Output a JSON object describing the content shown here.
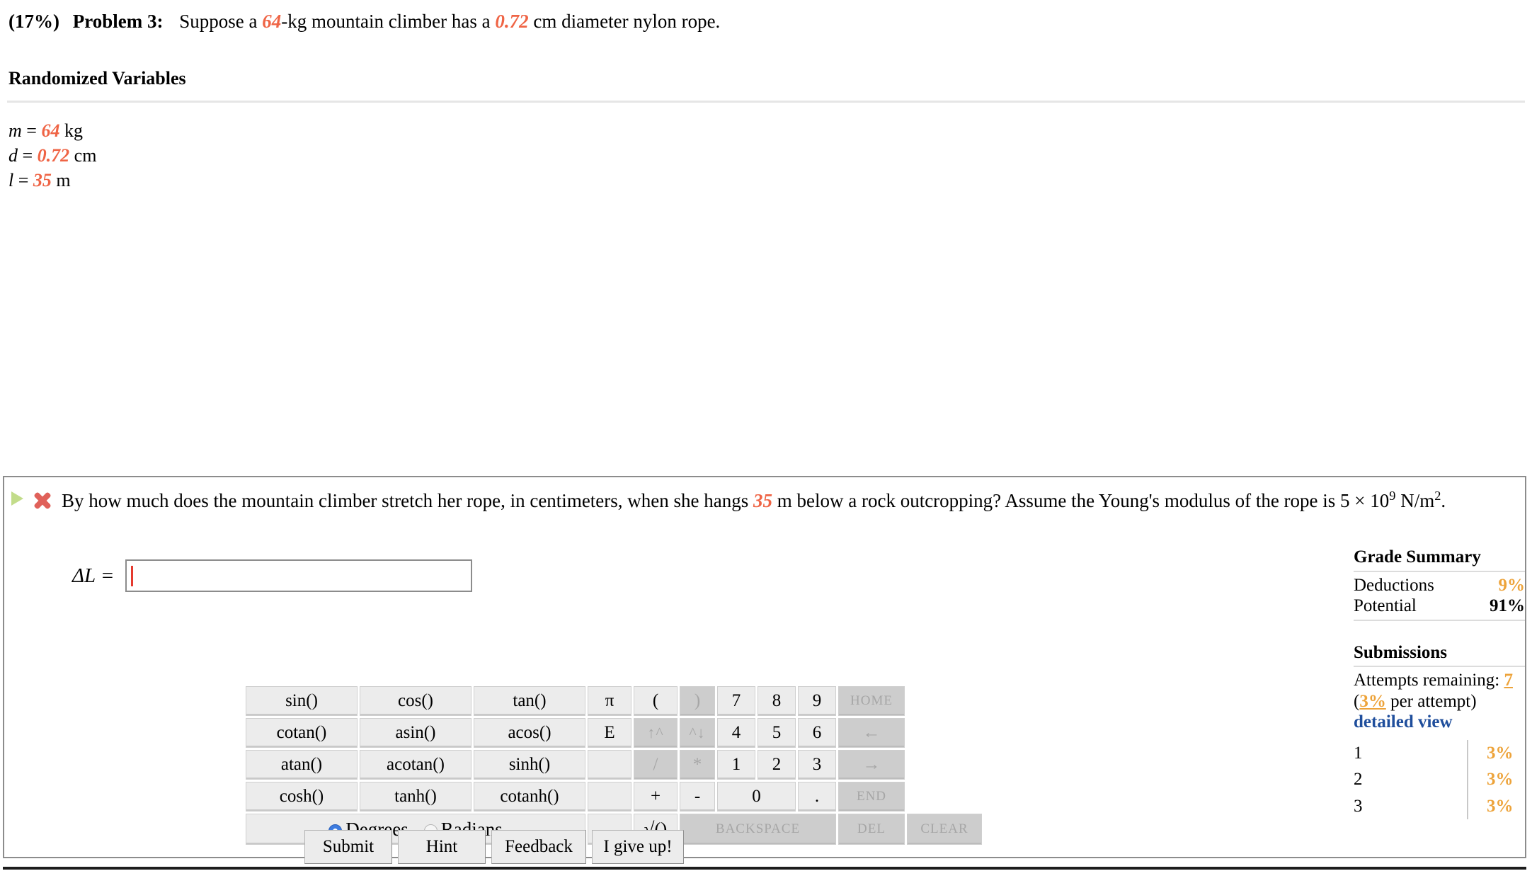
{
  "problem": {
    "percent": "(17%)",
    "number": "Problem 3:",
    "stem_pre": "Suppose a ",
    "mass_value": "64",
    "stem_mid": "-kg mountain climber has a ",
    "diameter_value": "0.72",
    "stem_post": " cm diameter nylon rope."
  },
  "randomized": {
    "title": "Randomized Variables",
    "variables": [
      {
        "symbol": "m",
        "eq": " = ",
        "value": "64",
        "unit": " kg"
      },
      {
        "symbol": "d",
        "eq": " = ",
        "value": "0.72",
        "unit": " cm"
      },
      {
        "symbol": "l",
        "eq": " = ",
        "value": "35",
        "unit": " m"
      }
    ]
  },
  "question": {
    "icons": {
      "expand": "play-triangle-icon",
      "status": "red-x-icon"
    },
    "text_pre": "By how much does the mountain climber stretch her rope, in centimeters, when she hangs ",
    "length_value": "35",
    "text_mid": " m below a rock outcropping? Assume the Young's modulus of the rope is 5 × 10",
    "exponent": "9",
    "text_post": " N/m",
    "unit_exponent": "2",
    "text_end": ".",
    "answer_label": "ΔL =",
    "answer_value": "",
    "answer_placeholder": ""
  },
  "calculator": {
    "rows": [
      [
        "sin()",
        "cos()",
        "tan()"
      ],
      [
        "cotan()",
        "asin()",
        "acos()"
      ],
      [
        "atan()",
        "acotan()",
        "sinh()"
      ],
      [
        "cosh()",
        "tanh()",
        "cotanh()"
      ]
    ],
    "col_pi": [
      "π",
      "E",
      "",
      ""
    ],
    "paren_open": "(",
    "paren_close": ")",
    "caret_up": "↑^",
    "caret_down": "^↓",
    "divide": "/",
    "multiply": "*",
    "plus": "+",
    "minus": "-",
    "sqrt": "√()",
    "digits": [
      [
        "7",
        "8",
        "9"
      ],
      [
        "4",
        "5",
        "6"
      ],
      [
        "1",
        "2",
        "3"
      ]
    ],
    "zero": "0",
    "dot": ".",
    "home": "HOME",
    "arrow_left": "←",
    "arrow_right": "→",
    "end": "END",
    "backspace": "BACKSPACE",
    "del": "DEL",
    "clear": "CLEAR",
    "mode_degrees": "Degrees",
    "mode_radians": "Radians",
    "mode_selected": "Degrees"
  },
  "actions": {
    "submit": "Submit",
    "hint": "Hint",
    "feedback": "Feedback",
    "give_up": "I give up!"
  },
  "grade_summary": {
    "title": "Grade Summary",
    "deductions_label": "Deductions",
    "deductions_value": "9%",
    "potential_label": "Potential",
    "potential_value": "91%",
    "submissions_title": "Submissions",
    "attempts_label": "Attempts remaining:",
    "attempts_value": "7",
    "per_attempt_open": "(",
    "per_attempt_value": "3%",
    "per_attempt_text": " per attempt)",
    "detailed_view": "detailed view",
    "attempts": [
      {
        "n": "1",
        "v": "3%"
      },
      {
        "n": "2",
        "v": "3%"
      },
      {
        "n": "3",
        "v": "3%"
      }
    ]
  },
  "colors": {
    "variable": "#ef6445",
    "orange": "#eda33a",
    "link": "#1f4e9c",
    "radio_on": "#3e7ce0"
  }
}
